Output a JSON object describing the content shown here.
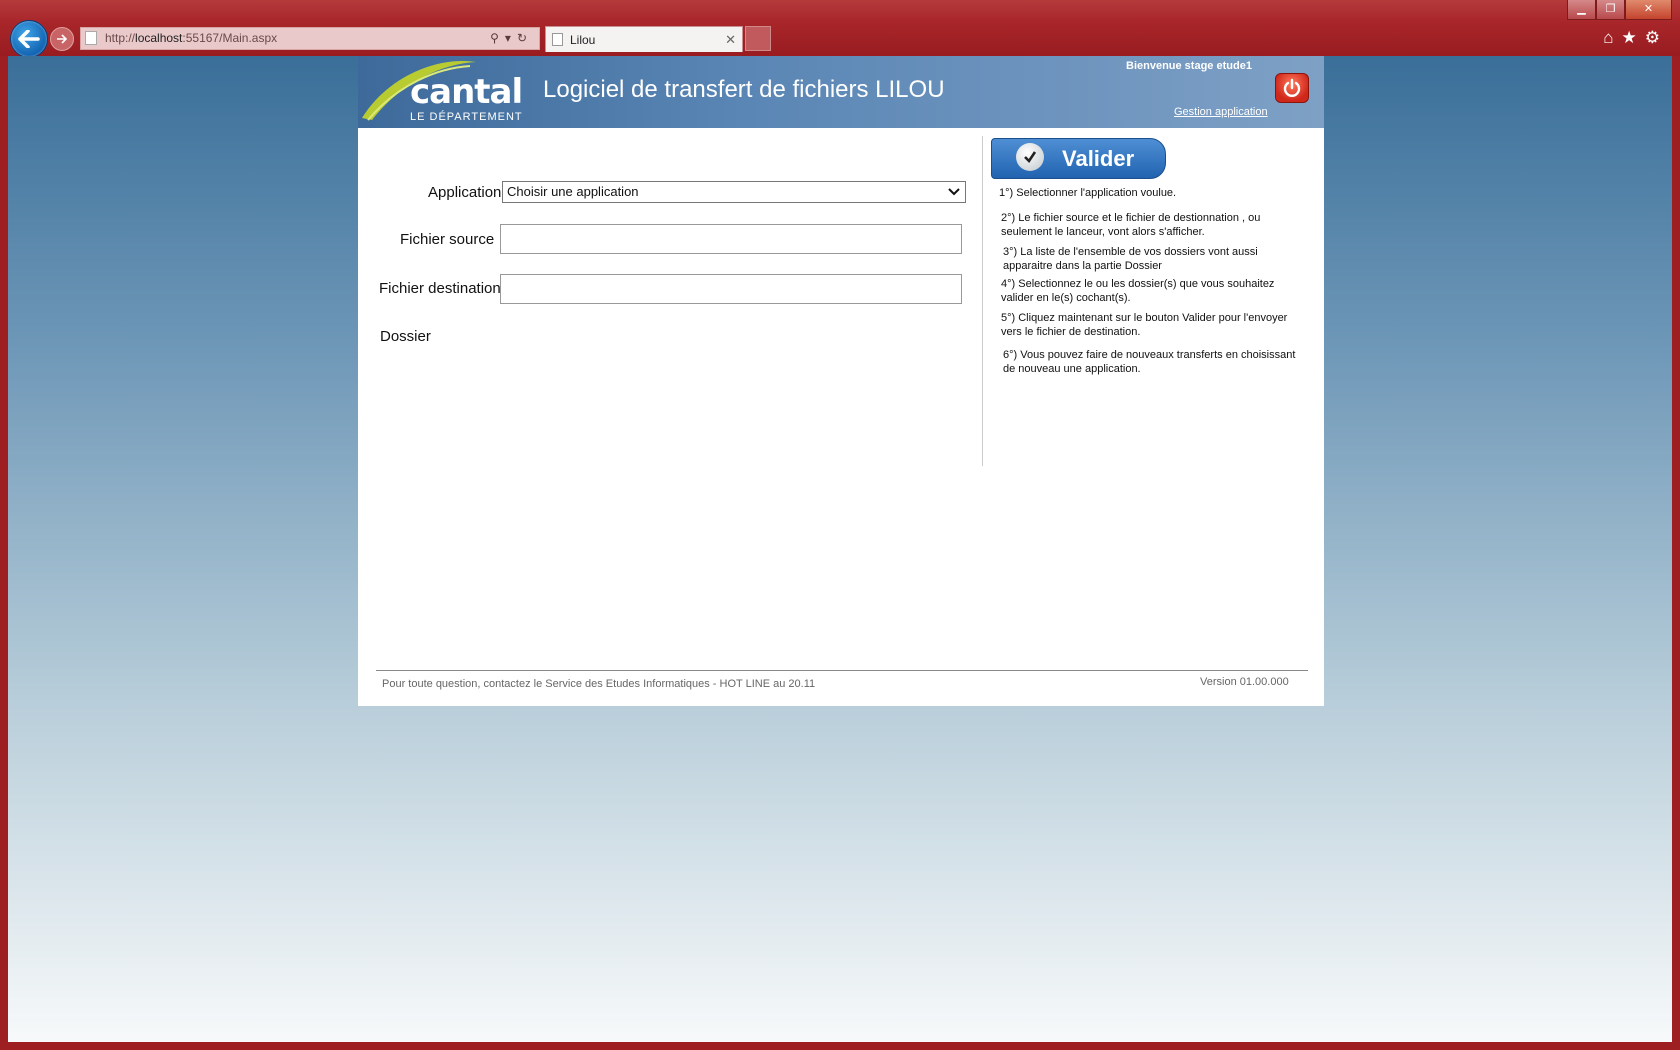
{
  "browser": {
    "url_prefix": "http://",
    "url_host": "localhost",
    "url_rest": ":55167/Main.aspx",
    "tab_title": "Lilou",
    "icons": [
      "back-icon",
      "forward-icon",
      "search-icon",
      "refresh-icon",
      "home-icon",
      "favorites-icon",
      "settings-icon"
    ]
  },
  "header": {
    "logo_main": "cantal",
    "logo_sub": "LE DÉPARTEMENT",
    "title": "Logiciel de transfert de fichiers LILOU",
    "welcome": "Bienvenue stage etude1",
    "gestion_link": "Gestion application"
  },
  "form": {
    "application_label": "Application",
    "application_selected": "Choisir une application",
    "source_label": "Fichier source",
    "source_value": "",
    "destination_label": "Fichier destination",
    "destination_value": "",
    "dossier_label": "Dossier"
  },
  "sidebar": {
    "valider_label": "Valider",
    "steps": [
      "1°) Selectionner l'application voulue.",
      "2°) Le fichier source et le fichier de destionnation , ou seulement le lanceur, vont alors s'afficher.",
      "3°) La liste de l'ensemble de vos dossiers vont aussi apparaitre dans la partie Dossier",
      "4°) Selectionnez le ou les dossier(s) que vous souhaitez valider en le(s) cochant(s).",
      "5°) Cliquez maintenant sur le bouton Valider pour l'envoyer vers le fichier de destination.",
      "6°) Vous pouvez faire de nouveaux transferts en choisissant de nouveau une application."
    ]
  },
  "footer": {
    "contact": "Pour toute question, contactez le Service des Etudes Informatiques - HOT LINE au 20.11",
    "version": "Version 01.00.000"
  },
  "colors": {
    "chrome": "#a8262a",
    "header_blue": "#5a86b5",
    "button_blue": "#2163b0"
  }
}
